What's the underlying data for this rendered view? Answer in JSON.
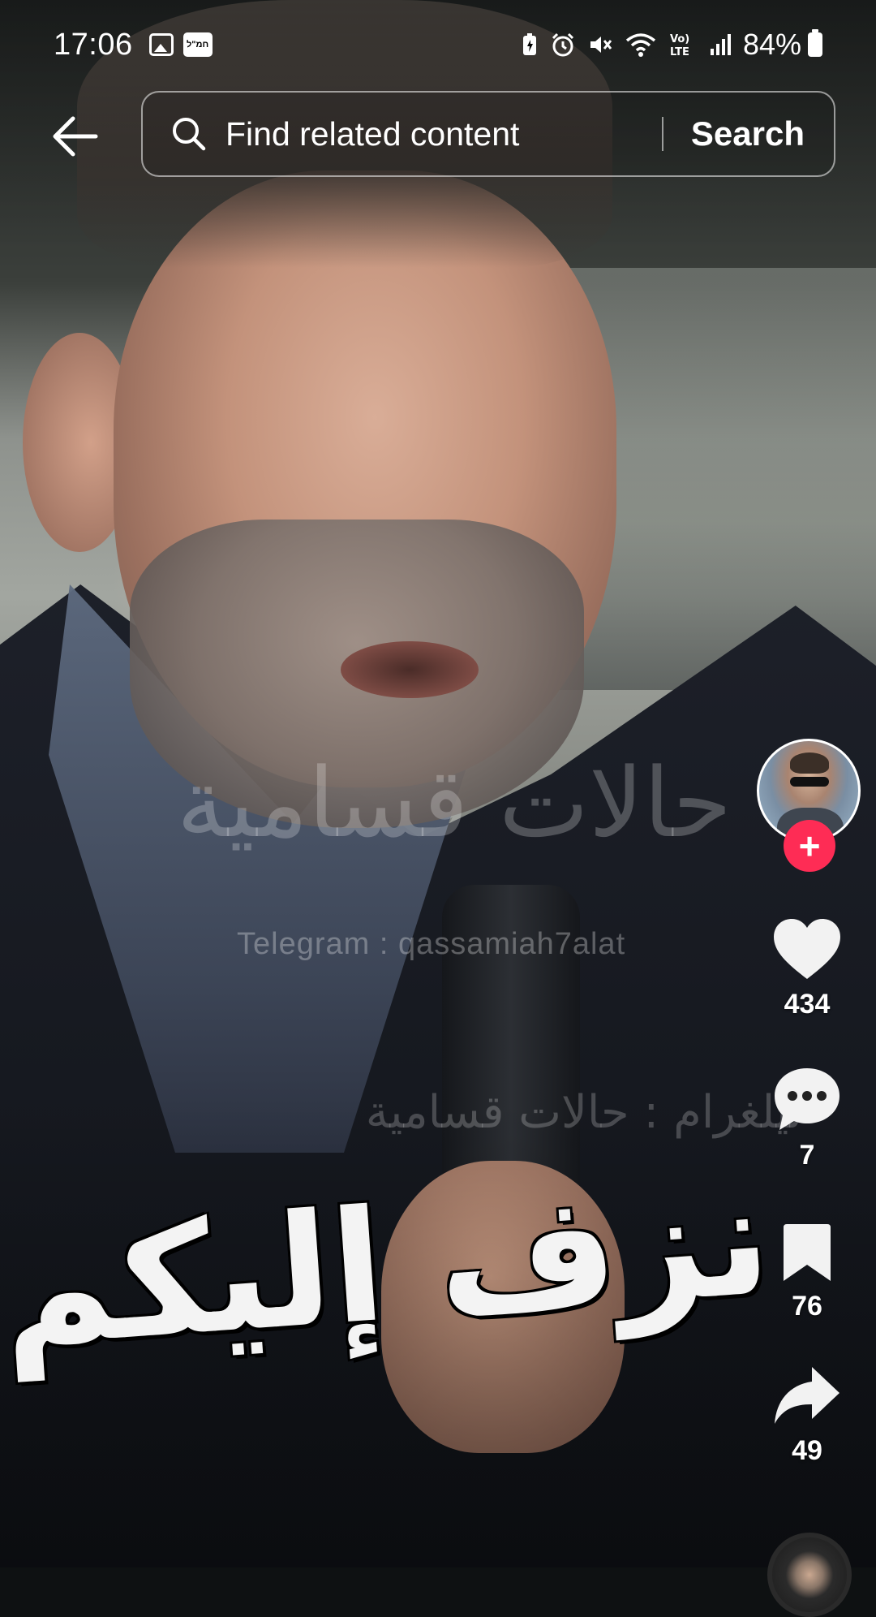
{
  "status_bar": {
    "time": "17:06",
    "badge_text": "חמ\"ל",
    "network_label": "Vo) LTE",
    "battery_percent": "84%"
  },
  "header": {
    "search_placeholder": "Find related content",
    "search_button": "Search"
  },
  "video": {
    "watermark_arabic": "حالات قسامية",
    "watermark_telegram": "Telegram : qassamiah7alat",
    "watermark_arabic_2": "تيلغرام : حالات قسامية",
    "caption_arabic": "نزف إليكم"
  },
  "actions": {
    "likes": "434",
    "comments": "7",
    "saves": "76",
    "shares": "49"
  },
  "colors": {
    "follow_accent": "#fe2c55",
    "icon_color": "#ffffff"
  }
}
